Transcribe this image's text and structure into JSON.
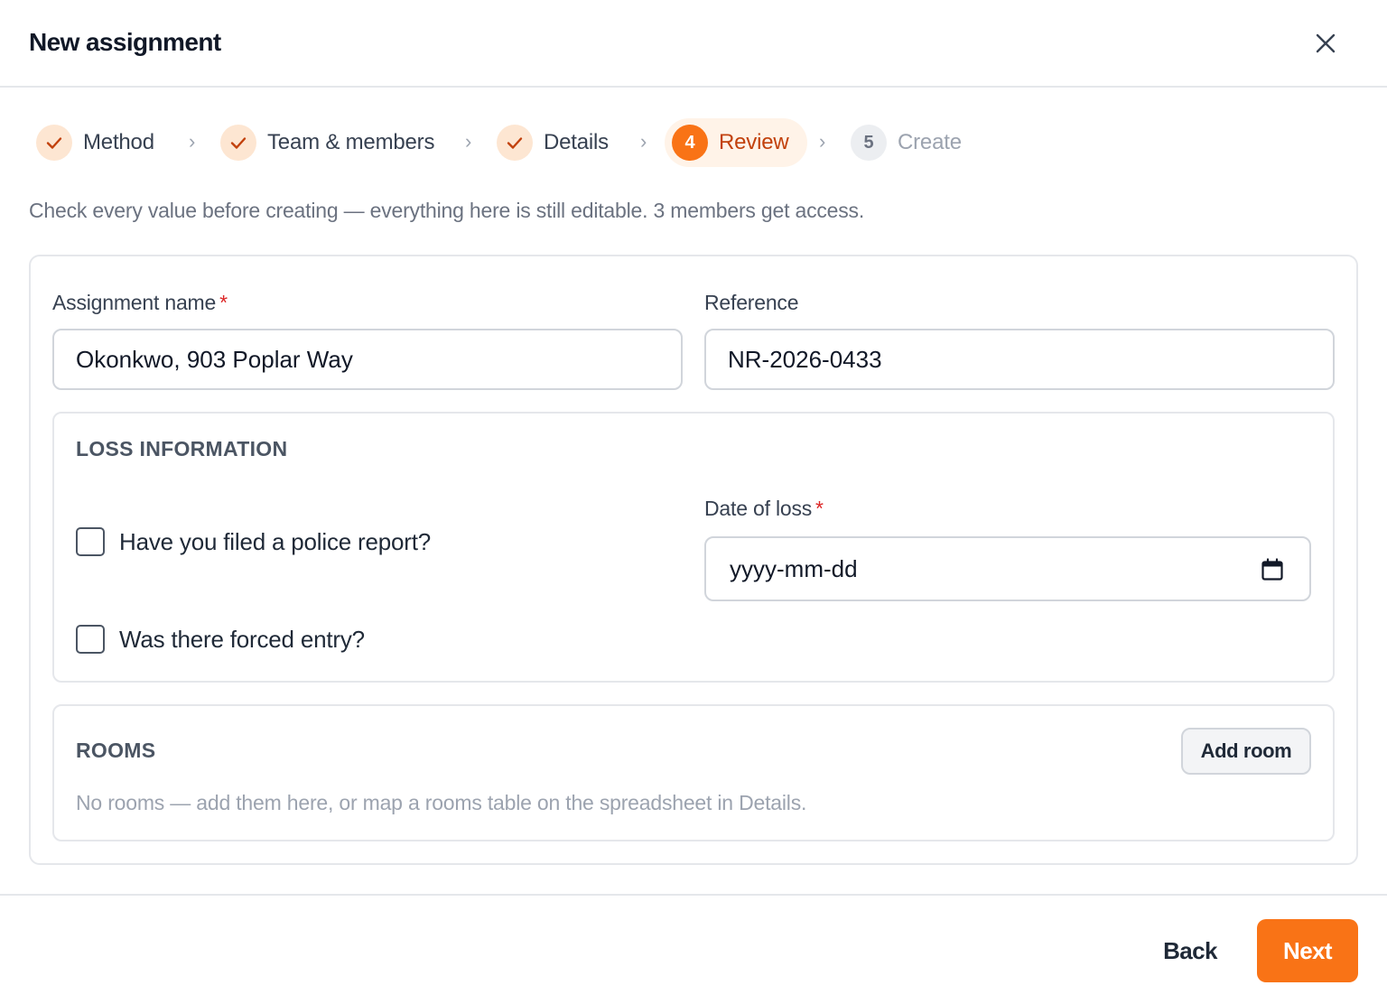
{
  "dialog": {
    "title": "New assignment",
    "close_icon": "close-icon"
  },
  "stepper": {
    "steps": [
      {
        "label": "Method",
        "status": "done",
        "icon": "check-icon"
      },
      {
        "label": "Team & members",
        "status": "done",
        "icon": "check-icon"
      },
      {
        "label": "Details",
        "status": "done",
        "icon": "check-icon"
      },
      {
        "number": "4",
        "label": "Review",
        "status": "active"
      },
      {
        "number": "5",
        "label": "Create",
        "status": "todo"
      }
    ],
    "separator": "›"
  },
  "intro": "Check every value before creating — everything here is still editable. 3 members get access.",
  "form": {
    "assignment_name": {
      "label": "Assignment name",
      "required_mark": "*",
      "value": "Okonkwo, 903 Poplar Way"
    },
    "reference": {
      "label": "Reference",
      "value": "NR-2026-0433"
    }
  },
  "loss_information": {
    "title": "LOSS INFORMATION",
    "police_report": {
      "label": "Have you filed a police report?",
      "checked": false
    },
    "forced_entry": {
      "label": "Was there forced entry?",
      "checked": false
    },
    "date_of_loss": {
      "label": "Date of loss",
      "required_mark": "*",
      "placeholder": "yyyy-mm-dd",
      "icon": "calendar-icon"
    }
  },
  "rooms": {
    "title": "ROOMS",
    "add_label": "Add room",
    "empty_text": "No rooms — add them here, or map a rooms table on the spreadsheet in Details."
  },
  "footer": {
    "back_label": "Back",
    "next_label": "Next"
  },
  "colors": {
    "accent": "#f97316",
    "accent_soft": "#fde6d2",
    "required": "#dc2626"
  }
}
